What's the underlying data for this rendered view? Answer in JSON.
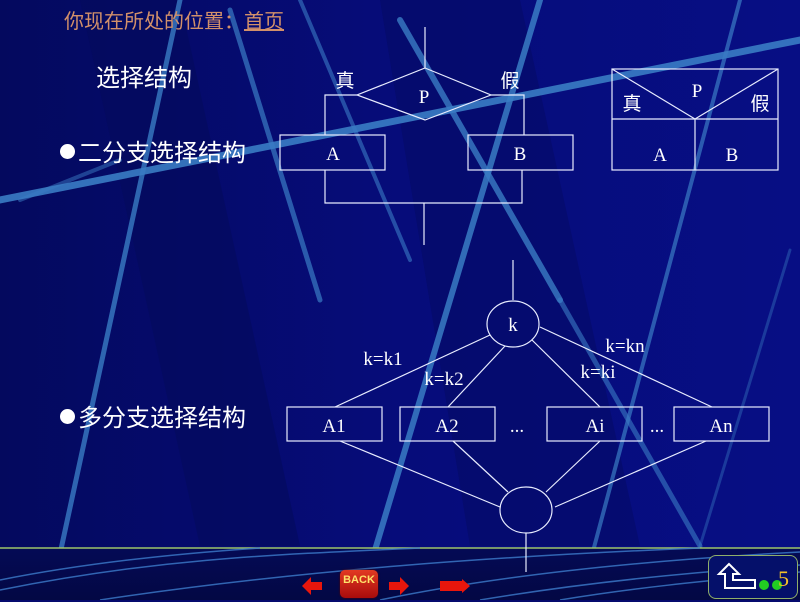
{
  "breadcrumb": {
    "prefix": "你现在所处的位置：",
    "link": "首页"
  },
  "heading": "选择结构",
  "bullets": [
    {
      "text": "二分支选择结构"
    },
    {
      "text": "多分支选择结构"
    }
  ],
  "flowchart_two_branch": {
    "condition": "P",
    "true_label": "真",
    "false_label": "假",
    "true_block": "A",
    "false_block": "B"
  },
  "ns_diagram": {
    "condition": "P",
    "true_label": "真",
    "false_label": "假",
    "true_block": "A",
    "false_block": "B"
  },
  "multi_branch": {
    "selector": "k",
    "edges": [
      "k=k1",
      "k=k2",
      "k=ki",
      "k=kn"
    ],
    "blocks": [
      "A1",
      "A2",
      "Ai",
      "An"
    ],
    "ellipses": [
      "...",
      "..."
    ]
  },
  "navigation": {
    "prev_icon": "arrow-left-icon",
    "back_label": "BACK",
    "next_icon": "arrow-right-icon",
    "end_icon": "arrow-end-icon",
    "home_icon": "return-arrow-icon",
    "page_number": "5"
  },
  "colors": {
    "background": "#050a6e",
    "breadcrumb": "#d2906a",
    "accent_streak": "#3a7cc4",
    "nav_red": "#e8160c",
    "page_number": "#f2c12a",
    "divider": "#9dc46a"
  }
}
